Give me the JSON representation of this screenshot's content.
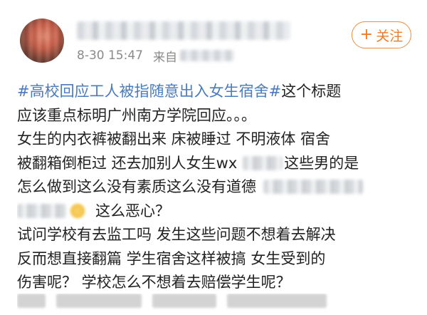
{
  "header": {
    "time": "8-30 15:47",
    "source_prefix": "来自",
    "follow_label": "关注",
    "follow_icon": "plus-icon"
  },
  "post": {
    "hashtag": "#高校回应工人被指随意出入女生宿舍#",
    "lines": [
      "这个标题",
      "应该重点标明广州南方学院回应。。。",
      "女生的内衣裤被翻出来  床被睡过   不明液体   宿舍",
      "被翻箱倒柜过   还去加别人女生wx",
      "这些男的是",
      "怎么做到这么没有素质这么没有道德",
      "这么恶心？",
      "试问学校有去监工吗  发生这些问题不想着去解决",
      "反而想直接翻篇   学生宿舍这样被搞   女生受到的",
      "伤害呢？   学校怎么不想着去赔偿学生呢？"
    ]
  }
}
